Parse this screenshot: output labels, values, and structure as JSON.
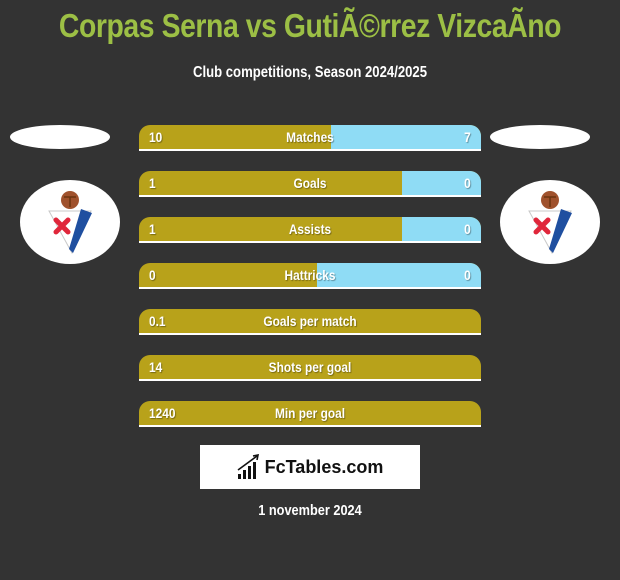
{
  "header": {
    "title": "Corpas Serna vs GutiÃ©rrez VizcaÃno",
    "subtitle": "Club competitions, Season 2024/2025"
  },
  "players": {
    "left": {
      "club_logo": "sd-eibar-crest-icon"
    },
    "right": {
      "club_logo": "sd-eibar-crest-icon"
    }
  },
  "colors": {
    "left_bar": "#b8a21a",
    "right_bar": "#8fdcf5",
    "title": "#9cbf45",
    "background": "#333333"
  },
  "stats": [
    {
      "label": "Matches",
      "left": "10",
      "right": "7",
      "left_share": 0.56
    },
    {
      "label": "Goals",
      "left": "1",
      "right": "0",
      "left_share": 0.77
    },
    {
      "label": "Assists",
      "left": "1",
      "right": "0",
      "left_share": 0.77
    },
    {
      "label": "Hattricks",
      "left": "0",
      "right": "0",
      "left_share": 0.52
    },
    {
      "label": "Goals per match",
      "left": "0.1",
      "right": "",
      "left_share": 1.0
    },
    {
      "label": "Shots per goal",
      "left": "14",
      "right": "",
      "left_share": 1.0
    },
    {
      "label": "Min per goal",
      "left": "1240",
      "right": "",
      "left_share": 1.0
    }
  ],
  "brand": {
    "name": "FcTables.com",
    "icon": "bar-chart-trend-icon"
  },
  "footer": {
    "date": "1 november 2024"
  }
}
